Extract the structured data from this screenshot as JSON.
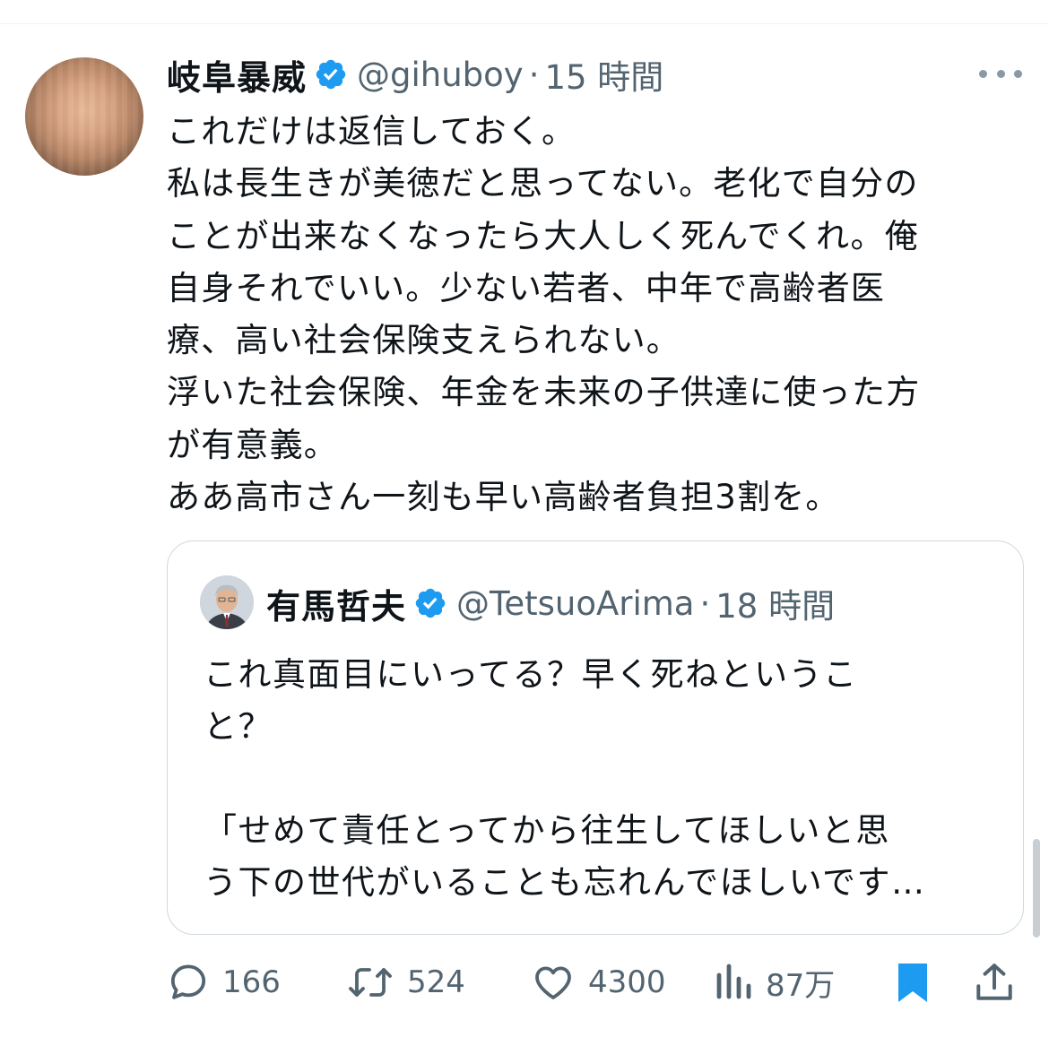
{
  "tweet": {
    "author_name": "岐阜暴威",
    "handle": "@gihuboy",
    "separator": "·",
    "time": "15 時間",
    "lines": [
      "これだけは返信しておく。",
      "私は長生きが美徳だと思ってない。老化で自分の",
      "ことが出来なくなったら大人しく死んでくれ。俺",
      "自身それでいい。少ない若者、中年で高齢者医",
      "療、高い社会保険支えられない。",
      "浮いた社会保険、年金を未来の子供達に使った方",
      "が有意義。",
      "ああ高市さん一刻も早い高齢者負担3割を。"
    ]
  },
  "quote": {
    "author_name": "有馬哲夫",
    "handle": "@TetsuoArima",
    "separator": "·",
    "time": "18 時間",
    "lines": [
      "これ真面目にいってる？早く死ねというこ",
      "と？",
      "",
      "「せめて責任とってから往生してほしいと思",
      "う下の世代がいることも忘れんでほしいです…"
    ]
  },
  "actions": {
    "replies": "166",
    "reposts": "524",
    "likes": "4300",
    "views": "87万"
  },
  "icons": {
    "verified": "verified-badge-icon",
    "more": "more-icon",
    "reply": "reply-icon",
    "repost": "repost-icon",
    "like": "like-icon",
    "views": "views-icon",
    "bookmark": "bookmark-icon",
    "share": "share-icon"
  },
  "colors": {
    "verified": "#1d9bf0",
    "bookmark": "#1d9bf0",
    "secondary_text": "#536471",
    "border": "#cfd9de"
  }
}
